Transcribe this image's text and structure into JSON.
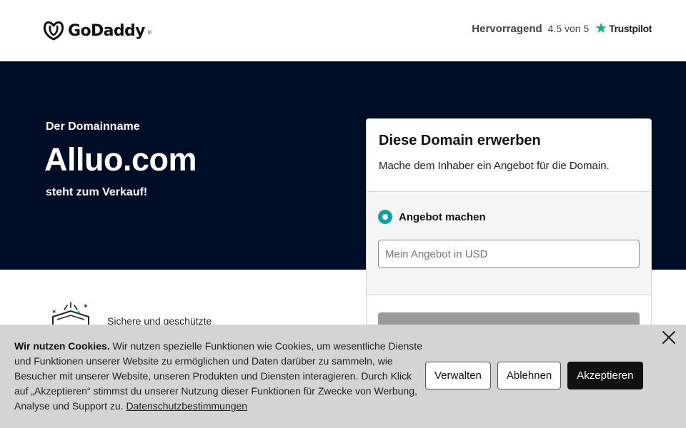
{
  "header": {
    "logo_text": "GoDaddy",
    "logo_tm": "®",
    "rating_label": "Hervorragend",
    "rating_score": "4.5 von 5",
    "trustpilot_name": "Trustpilot",
    "trustpilot_star": "★"
  },
  "hero": {
    "eyebrow": "Der Domainname",
    "domain": "Alluo.com",
    "subtitle": "steht zum Verkauf!"
  },
  "card": {
    "title": "Diese Domain erwerben",
    "description": "Mache dem Inhaber ein Angebot für die Domain.",
    "radio_label": "Angebot machen",
    "offer_placeholder": "Mein Angebot in USD"
  },
  "feature": {
    "text": "Sichere und geschützte"
  },
  "cookie": {
    "heading": "Wir nutzen Cookies.",
    "body": " Wir nutzen spezielle Funktionen wie Cookies, um wesentliche Dienste und Funktionen unserer Website zu ermöglichen und Daten darüber zu sammeln, wie Besucher mit unserer Website, unseren Produkten und Diensten interagieren. Durch Klick auf „Akzeptieren“ stimmst du unserer Nutzung dieser Funktionen für Zwecke von Werbung, Analyse und Support zu. ",
    "link": "Datenschutzbestimmungen",
    "buttons": {
      "manage": "Verwalten",
      "decline": "Ablehnen",
      "accept": "Akzeptieren"
    }
  },
  "colors": {
    "hero_bg": "#000d27",
    "accent_teal": "#09a6a0",
    "trustpilot_green": "#00b67a"
  }
}
